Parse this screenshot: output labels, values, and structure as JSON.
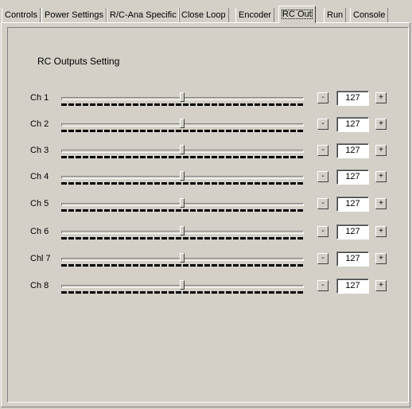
{
  "tabs": [
    {
      "label": "Controls"
    },
    {
      "label": "Power Settings"
    },
    {
      "label": "R/C-Ana Specific"
    },
    {
      "label": "Close Loop"
    },
    {
      "label": "Encoder"
    },
    {
      "label": "RC Out"
    },
    {
      "label": "Run"
    },
    {
      "label": "Console"
    }
  ],
  "active_tab": "RC Out",
  "section_title": "RC Outputs Setting",
  "controls": {
    "minus_label": "-",
    "plus_label": "+"
  },
  "slider_max": 255,
  "channels": [
    {
      "label": "Ch 1",
      "value": "127"
    },
    {
      "label": "Ch 2",
      "value": "127"
    },
    {
      "label": "Ch 3",
      "value": "127"
    },
    {
      "label": "Ch 4",
      "value": "127"
    },
    {
      "label": "Ch 5",
      "value": "127"
    },
    {
      "label": "Ch 6",
      "value": "127"
    },
    {
      "label": "Chl 7",
      "value": "127"
    },
    {
      "label": "Ch 8",
      "value": "127"
    }
  ]
}
